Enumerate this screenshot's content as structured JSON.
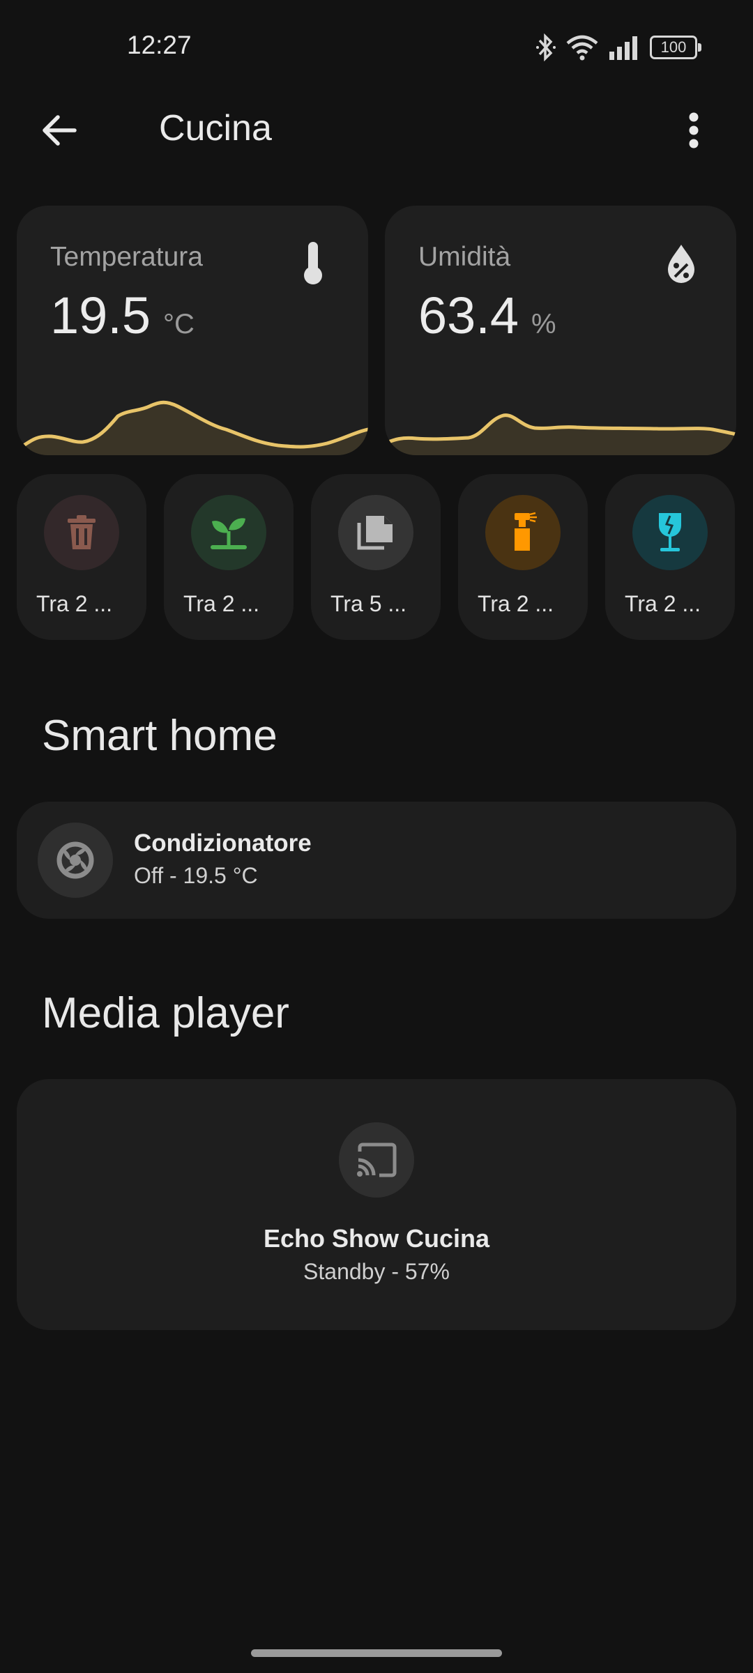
{
  "status_bar": {
    "time": "12:27",
    "battery": "100",
    "icons": [
      "bluetooth-icon",
      "wifi-icon",
      "signal-icon",
      "battery-icon"
    ]
  },
  "app_bar": {
    "title": "Cucina",
    "back_icon": "arrow-back-icon",
    "menu_icon": "more-vert-icon"
  },
  "sensors": [
    {
      "name": "Temperatura",
      "value": "19.5",
      "unit": "°C",
      "icon": "thermometer-icon",
      "sparkline_color": "#e8c469"
    },
    {
      "name": "Umidità",
      "value": "63.4",
      "unit": "%",
      "icon": "water-percent-icon",
      "sparkline_color": "#e8c469"
    }
  ],
  "chips": [
    {
      "label": "Tra 2 ...",
      "icon": "trash-can-icon",
      "color": "#8a5a4e",
      "bg": "#33282a"
    },
    {
      "label": "Tra 2 ...",
      "icon": "sprout-icon",
      "color": "#4caf50",
      "bg": "#23382a"
    },
    {
      "label": "Tra 5 ...",
      "icon": "paper-stack-icon",
      "color": "#b8b8b8",
      "bg": "#343434"
    },
    {
      "label": "Tra 2 ...",
      "icon": "spray-bottle-icon",
      "color": "#ff9800",
      "bg": "#4a3312"
    },
    {
      "label": "Tra 2 ...",
      "icon": "broken-glass-icon",
      "color": "#26c6da",
      "bg": "#16393f"
    }
  ],
  "smart_home": {
    "title": "Smart home",
    "device": {
      "name": "Condizionatore",
      "state": "Off - 19.5 °C",
      "icon": "air-conditioner-icon"
    }
  },
  "media_player": {
    "title": "Media player",
    "device": {
      "name": "Echo Show Cucina",
      "state": "Standby - 57%",
      "icon": "cast-icon"
    }
  }
}
